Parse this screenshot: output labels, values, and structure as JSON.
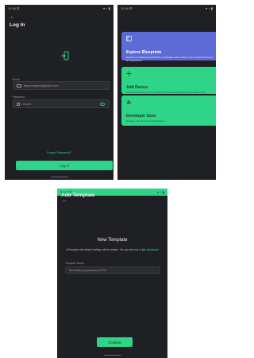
{
  "screens": {
    "login": {
      "status_time": "11:16 ☰",
      "status_icons": "▾ ◔ ▮",
      "back": "←",
      "title": "Log In",
      "email_label": "Email",
      "email_value": "tilepercalled@gmail.com",
      "password_label": "Password",
      "password_value": "••••••••",
      "forgot_label": "Forgot Password?",
      "login_button": "Log In"
    },
    "dashboard": {
      "status_time": "11:16 ☰",
      "status_icons": "▾ ◔ ▮",
      "cards": [
        {
          "title": "Explore Blueprints",
          "description": "Explore our curated blueprint library to simulate custom data for your connected devices and applications."
        },
        {
          "title": "Add Device",
          "description": "Connect your devices to the platform and start simulating telemetry data for them."
        },
        {
          "title": "Developer Zone",
          "description": "Manage your API keys and integrations."
        }
      ]
    },
    "add_template": {
      "status_time": "11:17 ☰",
      "status_icons": "▾ ◔ ▮",
      "back": "←",
      "title": "Add Template",
      "heading": "New Template",
      "description_prefix": "A Template with default settings will be created. You can see it at a",
      "description_link": "right dashboard",
      "field_label": "Template Name",
      "field_value": "Monitoring Apartment LPG",
      "continue_button": "Continue"
    }
  },
  "colors": {
    "accent": "#2ed488",
    "blue_card": "#5d6bd6",
    "screen_bg": "#1f2023"
  }
}
